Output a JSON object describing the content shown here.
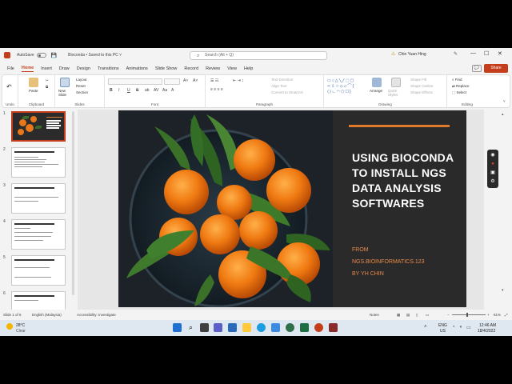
{
  "titlebar": {
    "autosave_label": "AutoSave",
    "autosave_state": "off",
    "doc_title": "Bioconda • Saved to this PC ˅",
    "search_placeholder": "Search (Alt + Q)",
    "user_name": "Chin Yuan Hing",
    "minimize": "—",
    "maximize": "☐",
    "close": "✕"
  },
  "tabs": [
    "File",
    "Home",
    "Insert",
    "Draw",
    "Design",
    "Transitions",
    "Animations",
    "Slide Show",
    "Record",
    "Review",
    "View",
    "Help"
  ],
  "active_tab": "Home",
  "share_label": "Share",
  "ribbon": {
    "undo_label": "Undo",
    "clipboard": {
      "paste": "Paste",
      "label": "Clipboard"
    },
    "slides": {
      "new_slide": "New Slide",
      "layout": "Layout",
      "reset": "Reset",
      "section": "Section",
      "label": "Slides"
    },
    "font": {
      "format_buttons": [
        "B",
        "I",
        "U",
        "S",
        "ab",
        "AV",
        "Aa",
        "A"
      ],
      "label": "Font"
    },
    "paragraph": {
      "text_direction": "Text Direction",
      "align_text": "Align Text",
      "smartart": "Convert to SmartArt",
      "label": "Paragraph"
    },
    "drawing": {
      "arrange": "Arrange",
      "quick_styles": "Quick Styles",
      "shape_fill": "Shape Fill",
      "shape_outline": "Shape Outline",
      "shape_effects": "Shape Effects",
      "label": "Drawing"
    },
    "editing": {
      "find": "Find",
      "replace": "Replace",
      "select": "Select",
      "label": "Editing"
    }
  },
  "thumbnails": [
    {
      "num": "1",
      "selected": true
    },
    {
      "num": "2",
      "selected": false
    },
    {
      "num": "3",
      "selected": false
    },
    {
      "num": "4",
      "selected": false
    },
    {
      "num": "5",
      "selected": false
    },
    {
      "num": "6",
      "selected": false
    }
  ],
  "slide": {
    "heading": "USING BIOCONDA TO INSTALL NGS DATA ANALYSIS SOFTWARES",
    "from_label": "FROM",
    "source": "NGS.BIOINFORMATICS.123",
    "author": "BY YH CHIN",
    "accent_color": "#e07a2a",
    "text_color": "#ffffff",
    "sub_color": "#e7894a"
  },
  "statusbar": {
    "slide_count": "Slide 1 of 6",
    "language": "English (Malaysia)",
    "accessibility": "Accessibility: Investigate",
    "notes": "Notes",
    "zoom": "61%"
  },
  "taskbar": {
    "temperature": "28°C",
    "weather": "Clear",
    "lang_top": "ENG",
    "lang_bottom": "US",
    "time": "12:46 AM",
    "date": "18/4/2022"
  },
  "colors": {
    "brand": "#c43e1c",
    "ribbon_bg": "#ffffff",
    "taskbar_bg": "#dfe7f1"
  }
}
